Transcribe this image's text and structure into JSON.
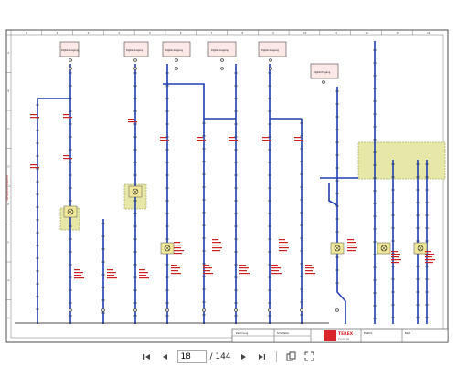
{
  "document": {
    "company": "TEREX",
    "brand": "FUCHS",
    "title_block_text": [
      "Zeichnung",
      "Schaltplan",
      "Elektrik",
      "Blatt"
    ],
    "left_margin_note": "Schaltplan Elektrik",
    "column_numbers": [
      "1",
      "2",
      "3",
      "4",
      "5",
      "6",
      "7",
      "8",
      "9",
      "10",
      "11",
      "12",
      "13",
      "14"
    ],
    "row_letters": [
      "A",
      "B",
      "C",
      "D",
      "E",
      "F",
      "G",
      "H"
    ],
    "module_labels": [
      "Digital Ausgang",
      "Digital Ausgang",
      "Digital Ausgang",
      "Digital Ausgang",
      "Digital Ausgang",
      "Digital Eingang"
    ],
    "colors": {
      "wire_blue": "#1f3fb0",
      "wire_dark": "#111111",
      "label_red": "#cc2222",
      "yellow_box": "#e7e8a8",
      "module_box": "#fde8e8"
    }
  },
  "toolbar": {
    "first_page_icon": "first-page-icon",
    "prev_page_icon": "prev-page-icon",
    "current_page": "18",
    "total_pages": "/ 144",
    "next_page_icon": "next-page-icon",
    "last_page_icon": "last-page-icon",
    "copy_icon": "copy-icon",
    "fullscreen_icon": "fullscreen-icon"
  }
}
